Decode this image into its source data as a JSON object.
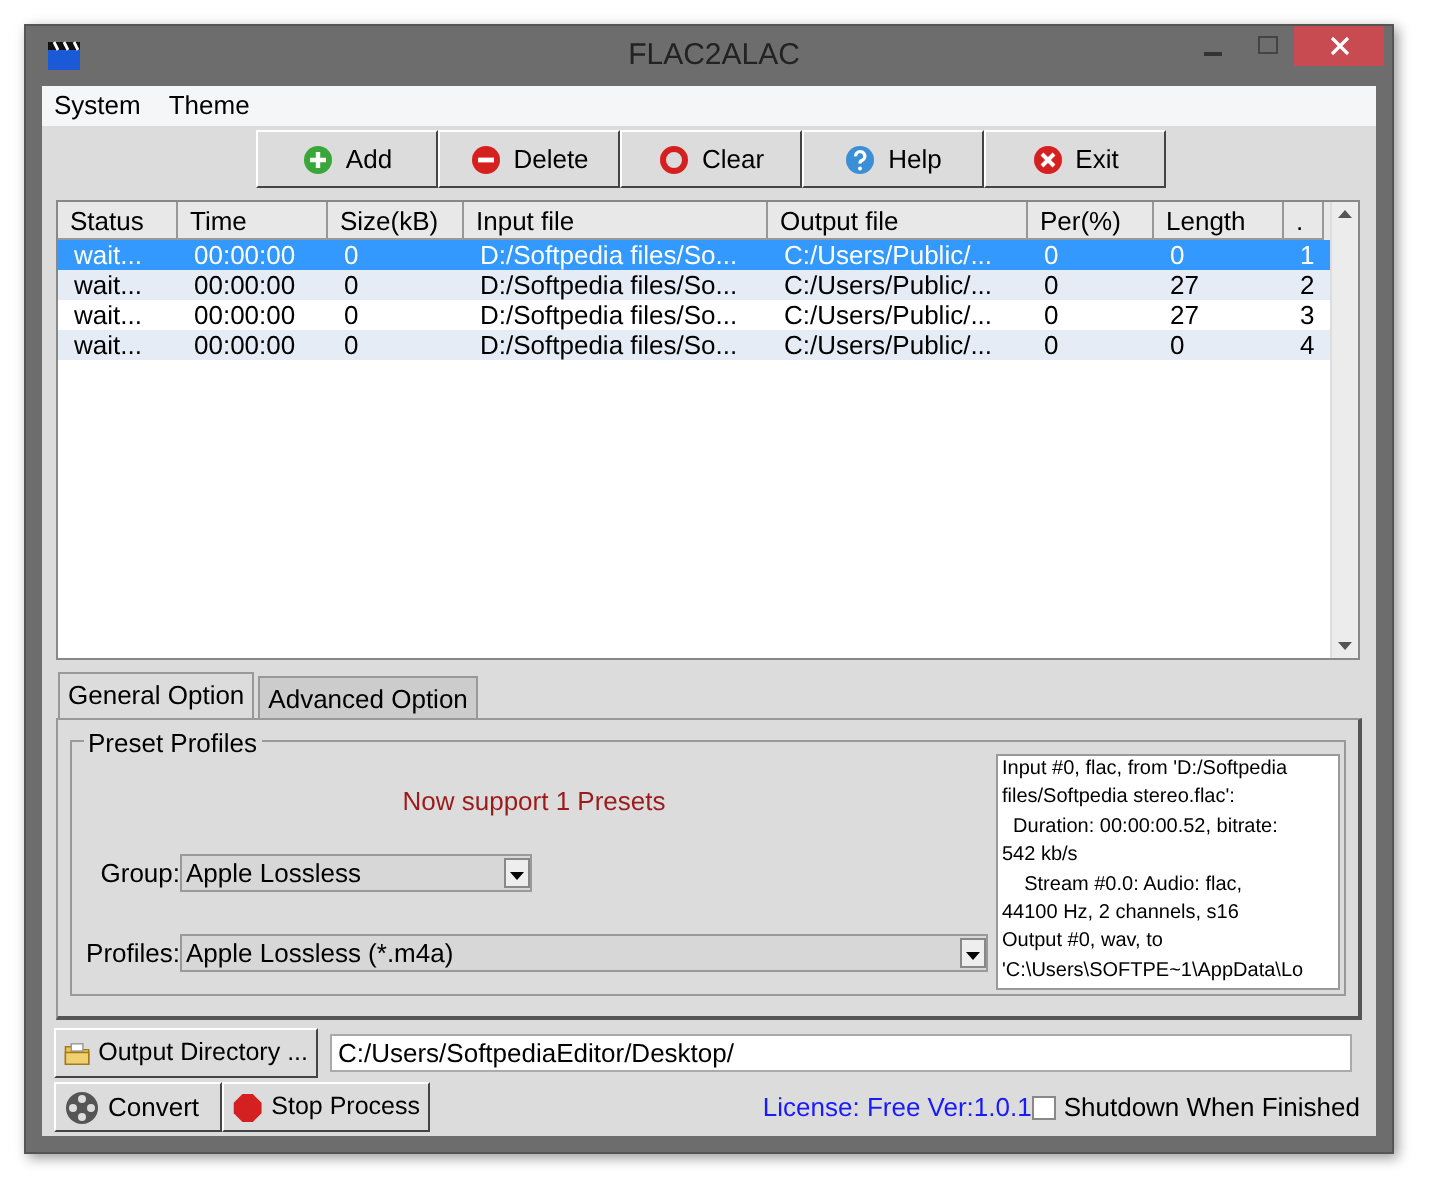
{
  "window": {
    "title": "FLAC2ALAC"
  },
  "menu": [
    {
      "label": "System"
    },
    {
      "label": "Theme"
    }
  ],
  "toolbar": [
    {
      "label": "Add",
      "kind": "add"
    },
    {
      "label": "Delete",
      "kind": "delete"
    },
    {
      "label": "Clear",
      "kind": "clear"
    },
    {
      "label": "Help",
      "kind": "help"
    },
    {
      "label": "Exit",
      "kind": "exit"
    }
  ],
  "table": {
    "columns": [
      "Status",
      "Time",
      "Size(kB)",
      "Input file",
      "Output file",
      "Per(%)",
      "Length",
      "."
    ],
    "rows": [
      {
        "selected": true,
        "cells": [
          "wait...",
          "00:00:00",
          "0",
          "D:/Softpedia files/So...",
          "C:/Users/Public/...",
          "0",
          "0",
          "1"
        ]
      },
      {
        "selected": false,
        "cells": [
          "wait...",
          "00:00:00",
          "0",
          "D:/Softpedia files/So...",
          "C:/Users/Public/...",
          "0",
          "27",
          "2"
        ]
      },
      {
        "selected": false,
        "cells": [
          "wait...",
          "00:00:00",
          "0",
          "D:/Softpedia files/So...",
          "C:/Users/Public/...",
          "0",
          "27",
          "3"
        ]
      },
      {
        "selected": false,
        "cells": [
          "wait...",
          "00:00:00",
          "0",
          "D:/Softpedia files/So...",
          "C:/Users/Public/...",
          "0",
          "0",
          "4"
        ]
      }
    ]
  },
  "tabs": [
    {
      "label": "General Option",
      "selected": true
    },
    {
      "label": "Advanced Option",
      "selected": false
    }
  ],
  "preset_profiles": {
    "title": "Preset Profiles",
    "notice": "Now support 1 Presets",
    "group": {
      "label": "Group:",
      "value": "Apple Lossless"
    },
    "profiles": {
      "label": "Profiles:",
      "value": "Apple Lossless (*.m4a)"
    },
    "log": [
      "Input #0, flac, from 'D:/Softpedia",
      "files/Softpedia stereo.flac':",
      "  Duration: 00:00:00.52, bitrate:",
      "542 kb/s",
      "    Stream #0.0: Audio: flac,",
      "44100 Hz, 2 channels, s16",
      "Output #0, wav, to",
      "'C:\\Users\\SOFTPE~1\\AppData\\Lo"
    ]
  },
  "output_directory": {
    "button": "Output Directory ...",
    "value": "C:/Users/SoftpediaEditor/Desktop/"
  },
  "convert_button": "Convert",
  "stop_button": "Stop Process",
  "license": "License: Free Ver:1.0.1",
  "shutdown": {
    "label": "Shutdown When Finished",
    "checked": false
  }
}
